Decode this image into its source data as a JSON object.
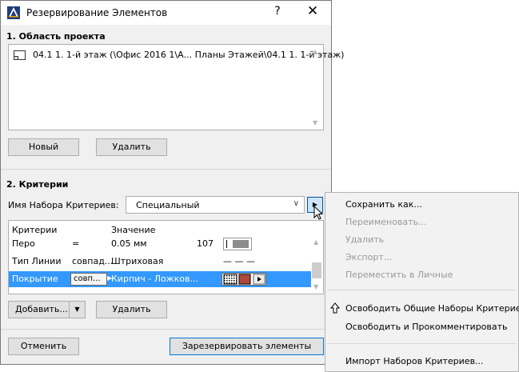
{
  "window": {
    "title": "Резервирование Элементов",
    "help_label": "?",
    "close_label": "✕"
  },
  "project_area": {
    "heading": "1. Область проекта",
    "items": [
      {
        "label": "04.1 1. 1-й этаж (\\Офис 2016 1\\А... Планы Этажей\\04.1 1. 1-й этаж)"
      }
    ],
    "new_label": "Новый",
    "delete_label": "Удалить"
  },
  "criteria": {
    "heading": "2. Критерии",
    "set_label": "Имя Набора Критериев:",
    "set_value": "Специальный",
    "more_label": "▶",
    "columns": [
      "Критерии",
      "Значение"
    ],
    "rows": [
      {
        "name": "Перо",
        "op": "=",
        "value": "0.05 мм",
        "extra": "107"
      },
      {
        "name": "Тип Линии",
        "op": "совпад...",
        "value": "Штриховая",
        "extra": "— — —"
      },
      {
        "name": "Покрытие",
        "op": "совп...",
        "value": "Кирпич - Ложков...",
        "extra": ""
      }
    ],
    "add_label": "Добавить...",
    "delete_label": "Удалить"
  },
  "footer": {
    "cancel_label": "Отменить",
    "reserve_label": "Зарезервировать элементы"
  },
  "context_menu": {
    "items": [
      {
        "label": "Сохранить как...",
        "enabled": true
      },
      {
        "label": "Переименовать...",
        "enabled": false
      },
      {
        "label": "Удалить",
        "enabled": false
      },
      {
        "label": "Экспорт...",
        "enabled": false
      },
      {
        "label": "Переместить в Личные",
        "enabled": false
      },
      {
        "label": "Освободить Общие Наборы Критериев",
        "enabled": true
      },
      {
        "label": "Освободить и Прокомментировать",
        "enabled": true
      },
      {
        "label": "Импорт Наборов Критериев...",
        "enabled": true
      }
    ]
  },
  "colors": {
    "selection": "#3399ff",
    "accent_border": "#0078d7",
    "surface_swatch": "#b0493a"
  },
  "icons": {
    "app": "archicad-icon",
    "plan": "floor-plan-icon",
    "expand": "arrow-right-icon",
    "upload": "arrow-up-icon"
  }
}
